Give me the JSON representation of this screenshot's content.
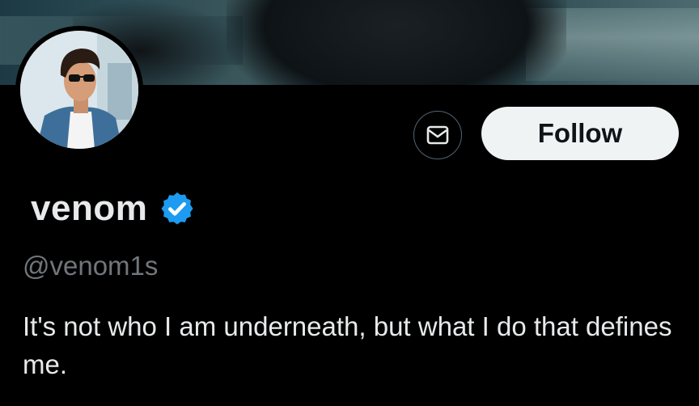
{
  "profile": {
    "display_name": "venom",
    "handle": "@venom1s",
    "bio": "It's not who I am underneath, but what I do that defines me.",
    "verified": true
  },
  "actions": {
    "message_icon": "envelope-icon",
    "follow_label": "Follow"
  },
  "colors": {
    "background": "#000000",
    "verified_badge": "#1d9bf0",
    "follow_button_bg": "#eff3f4",
    "muted_text": "#71767b"
  }
}
